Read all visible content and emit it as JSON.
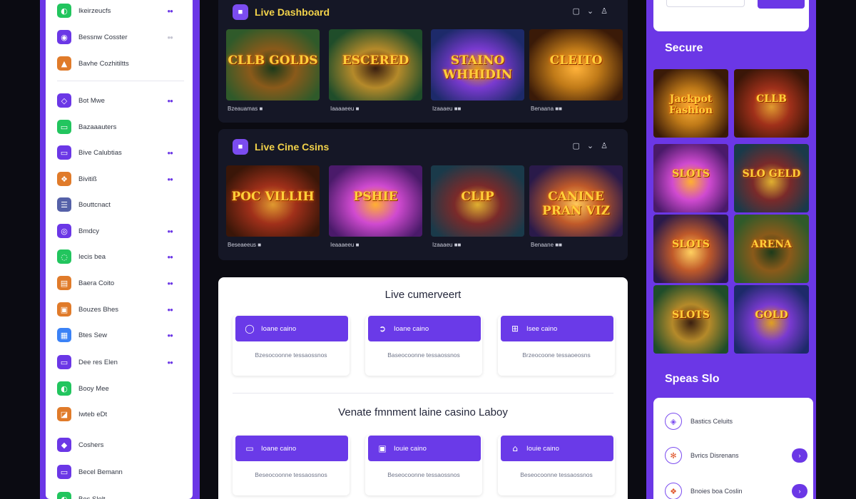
{
  "sidebar": {
    "items": [
      {
        "label": "Ikeirzeucfs",
        "icon": "chat-icon",
        "color": "#22c55e",
        "glyph": "◐",
        "dot": true,
        "dot_grey": false
      },
      {
        "label": "Bessnw Cosster",
        "icon": "circle-icon",
        "color": "#6b37e6",
        "glyph": "◉",
        "dot": true,
        "dot_grey": true
      },
      {
        "label": "Bavhe Cozhitiltts",
        "icon": "image-icon",
        "color": "#e07b2a",
        "glyph": "▲",
        "dot": false,
        "dot_grey": false
      },
      {
        "label": "Bot Mwe",
        "icon": "tag-icon",
        "color": "#6b37e6",
        "glyph": "◇",
        "dot": true,
        "dot_grey": false
      },
      {
        "label": "Bazaaauters",
        "icon": "message-icon",
        "color": "#22c55e",
        "glyph": "▭",
        "dot": false,
        "dot_grey": false
      },
      {
        "label": "Bive Calubtias",
        "icon": "card-icon",
        "color": "#6b37e6",
        "glyph": "▭",
        "dot": true,
        "dot_grey": false
      },
      {
        "label": "Bivitiß",
        "icon": "gift-icon",
        "color": "#e07b2a",
        "glyph": "❖",
        "dot": true,
        "dot_grey": false
      },
      {
        "label": "Bouttcnact",
        "icon": "list-icon",
        "color": "#5561a8",
        "glyph": "☰",
        "dot": false,
        "dot_grey": false
      },
      {
        "label": "Bmdcy",
        "icon": "chip-icon",
        "color": "#6b37e6",
        "glyph": "◎",
        "dot": true,
        "dot_grey": false
      },
      {
        "label": "Iecis bea",
        "icon": "speech-icon",
        "color": "#22c55e",
        "glyph": "◌",
        "dot": true,
        "dot_grey": false
      },
      {
        "label": "Baera Coito",
        "icon": "ticket-icon",
        "color": "#e07b2a",
        "glyph": "▤",
        "dot": true,
        "dot_grey": false
      },
      {
        "label": "Bouzes Bhes",
        "icon": "wallet-icon",
        "color": "#e07b2a",
        "glyph": "▣",
        "dot": true,
        "dot_grey": false
      },
      {
        "label": "Btes Sew",
        "icon": "apps-icon",
        "color": "#3b82f6",
        "glyph": "▦",
        "dot": true,
        "dot_grey": false
      },
      {
        "label": "Dee res Elen",
        "icon": "trophy-icon",
        "color": "#6b37e6",
        "glyph": "▭",
        "dot": true,
        "dot_grey": false
      },
      {
        "label": "Booy Mee",
        "icon": "chat-icon",
        "color": "#22c55e",
        "glyph": "◐",
        "dot": false,
        "dot_grey": false
      },
      {
        "label": "Iwteb eDt",
        "icon": "bag-icon",
        "color": "#e07b2a",
        "glyph": "◪",
        "dot": false,
        "dot_grey": false
      },
      {
        "label": "Coshers",
        "icon": "shield-icon",
        "color": "#6b37e6",
        "glyph": "◆",
        "dot": false,
        "dot_grey": false
      },
      {
        "label": "Becel Bemann",
        "icon": "note-icon",
        "color": "#6b37e6",
        "glyph": "▭",
        "dot": false,
        "dot_grey": false
      },
      {
        "label": "Bes Slelt",
        "icon": "chat-icon",
        "color": "#22c55e",
        "glyph": "◐",
        "dot": false,
        "dot_grey": false
      }
    ]
  },
  "panels": [
    {
      "title": "Live Dashboard",
      "tools": [
        "▢",
        "⌄",
        "♙"
      ],
      "tiles": [
        {
          "art": "CLLB GOLDS",
          "caption": "Bzeauamas ■"
        },
        {
          "art": "ESCERED",
          "caption": "Iaaaaeeu ■"
        },
        {
          "art": "STAINO WHHIDIN",
          "caption": "Izaaaeu ■■"
        },
        {
          "art": "CLEITO",
          "caption": "Benaana ■■"
        }
      ]
    },
    {
      "title": "Live Cine Csins",
      "tools": [
        "▢",
        "⌄",
        "♙"
      ],
      "tiles": [
        {
          "art": "POC VILLIH",
          "caption": "Beseaeeus ■"
        },
        {
          "art": "PSHIE",
          "caption": "Ieaaaeeu ■"
        },
        {
          "art": "CLIP",
          "caption": "Izaaaeu ■■"
        },
        {
          "art": "CANINE PRAN VIZ",
          "caption": "Benaane ■■"
        }
      ]
    }
  ],
  "card": {
    "title1": "Live cumerveert",
    "row1": [
      {
        "button": "Ioane caino",
        "icon": "chat-icon",
        "glyph": "◯",
        "desc": "Bzesocoonne tessaossnos"
      },
      {
        "button": "Ioane caino",
        "icon": "arrow-icon",
        "glyph": "➲",
        "desc": "Baseocoonne tessaossnos"
      },
      {
        "button": "Isee caino",
        "icon": "chip-icon",
        "glyph": "⊞",
        "desc": "Brzeocoone tessaoeosns"
      }
    ],
    "title2": "Venate fmnment laine casino Laboy",
    "row2": [
      {
        "button": "Ioane caino",
        "icon": "message-icon",
        "glyph": "▭",
        "desc": "Beseocoonne tessaossnos"
      },
      {
        "button": "Iouie caino",
        "icon": "card-icon",
        "glyph": "▣",
        "desc": "Beseocoonne tessaossnos"
      },
      {
        "button": "Iouie caino",
        "icon": "bank-icon",
        "glyph": "⌂",
        "desc": "Beseocoonne tessaossnos"
      }
    ]
  },
  "right": {
    "heading1": "Secure",
    "heading2": "Speas Slo",
    "tiles": [
      {
        "art": "Jackpot Fashion"
      },
      {
        "art": "CLLB"
      },
      {
        "art": "SLOTS"
      },
      {
        "art": "SLO GELD"
      },
      {
        "art": "SLOTS"
      },
      {
        "art": "ARENA"
      },
      {
        "art": "SLOTS"
      },
      {
        "art": "GOLD"
      }
    ],
    "list": [
      {
        "label": "Bastics Celuits",
        "icon": "chip-icon",
        "glyph": "◈"
      },
      {
        "label": "Bvrics Disrenans",
        "icon": "gear-icon",
        "glyph": "✻"
      },
      {
        "label": "Bnoies boa Coslin",
        "icon": "gift-icon",
        "glyph": "❖"
      }
    ]
  },
  "colors": {
    "accent": "#6b37e6",
    "gold": "#f2d24a",
    "panel": "#151726"
  }
}
